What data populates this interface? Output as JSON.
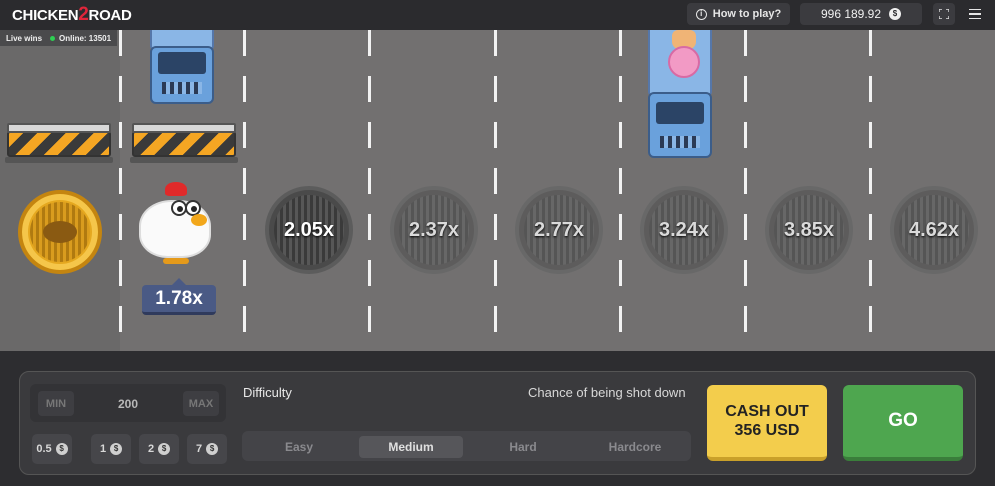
{
  "header": {
    "logo_pre": "CHICKEN",
    "logo_mid": "2",
    "logo_post": "ROAD",
    "how_to_play": "How to play?",
    "balance": "996 189.92",
    "currency_icon": "$"
  },
  "live": {
    "label": "Live wins",
    "online": "Online: 13501"
  },
  "game": {
    "current_multiplier": "1.78x",
    "multipliers": [
      "2.05x",
      "2.37x",
      "2.77x",
      "3.24x",
      "3.85x",
      "4.62x"
    ]
  },
  "controls": {
    "min_label": "MIN",
    "max_label": "MAX",
    "bet_value": "200",
    "chips": [
      "0.5",
      "1",
      "2",
      "7"
    ],
    "chip_icon": "$",
    "difficulty_label": "Difficulty",
    "chance_label": "Chance of being shot down",
    "difficulties": [
      "Easy",
      "Medium",
      "Hard",
      "Hardcore"
    ],
    "selected_difficulty": "Medium",
    "cashout_line1": "CASH OUT",
    "cashout_line2": "356 USD",
    "go_label": "GO"
  },
  "colors": {
    "cashout": "#f3cd4c",
    "go": "#4ea64f",
    "road": "#727070"
  }
}
